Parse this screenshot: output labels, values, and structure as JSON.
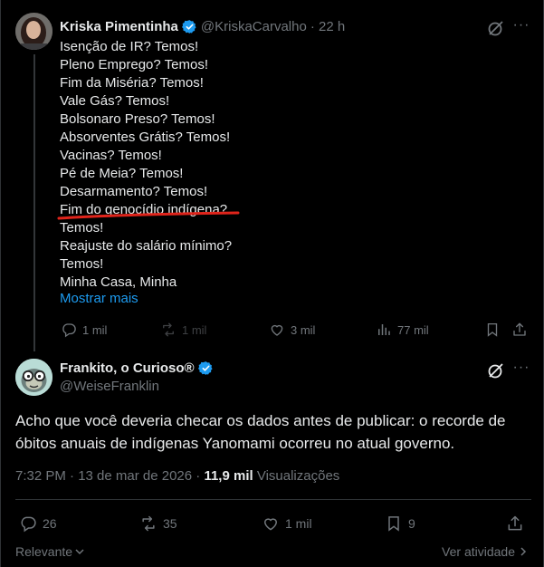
{
  "original_tweet": {
    "author_name": "Kriska Pimentinha",
    "author_handle": "@KriskaCarvalho",
    "time": "· 22 h",
    "lines": [
      "Isenção de IR? Temos!",
      "Pleno Emprego? Temos!",
      "Fim da Miséria? Temos!",
      "Vale Gás? Temos!",
      "Bolsonaro Preso? Temos!",
      "Absorventes Grátis? Temos!",
      "Vacinas? Temos!",
      "Pé de Meia? Temos!",
      "Desarmamento? Temos!",
      "Fim do genocídio indígena?",
      "Temos!",
      "Reajuste do salário mínimo?",
      "Temos!",
      "Minha Casa, Minha"
    ],
    "show_more": "Mostrar mais",
    "replies": "1 mil",
    "reposts": "1 mil",
    "likes": "3 mil",
    "views": "77 mil"
  },
  "reply_tweet": {
    "author_name": "Frankito, o Curioso®",
    "author_handle": "@WeiseFranklin",
    "text": "Acho que você deveria checar os dados antes de publicar: o recorde de óbitos anuais de indígenas Yanomami ocorreu no atual governo.",
    "timestamp": "7:32 PM · 13 de mar de 2026 · ",
    "views_count": "11,9 mil",
    "views_label": "Visualizações",
    "replies": "26",
    "reposts": "35",
    "likes": "1 mil",
    "bookmarks": "9"
  },
  "footer": {
    "sort_label": "Relevante",
    "activity_label": "Ver atividade"
  },
  "colors": {
    "background": "#000000",
    "text": "#e7e9ea",
    "muted": "#71767b",
    "link": "#1d9bf0",
    "verified": "#1d9bf0",
    "annotation": "#e0241b"
  }
}
